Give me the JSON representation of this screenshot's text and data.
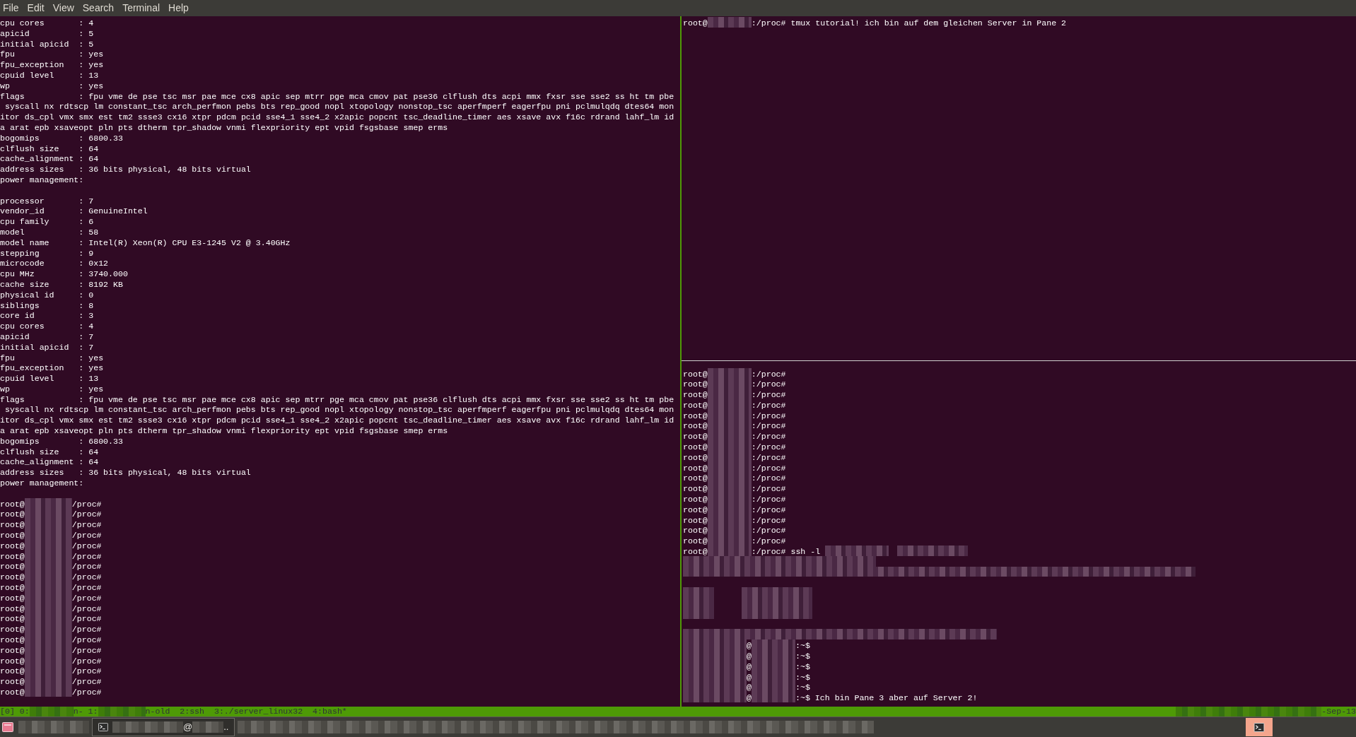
{
  "menu": [
    "File",
    "Edit",
    "View",
    "Search",
    "Terminal",
    "Help"
  ],
  "left_pane": {
    "lines": [
      {
        "kind": "text",
        "text": "cpu cores       : 4"
      },
      {
        "kind": "text",
        "text": "apicid          : 5"
      },
      {
        "kind": "text",
        "text": "initial apicid  : 5"
      },
      {
        "kind": "text",
        "text": "fpu             : yes"
      },
      {
        "kind": "text",
        "text": "fpu_exception   : yes"
      },
      {
        "kind": "text",
        "text": "cpuid level     : 13"
      },
      {
        "kind": "text",
        "text": "wp              : yes"
      },
      {
        "kind": "text",
        "text": "flags           : fpu vme de pse tsc msr pae mce cx8 apic sep mtrr pge mca cmov pat pse36 clflush dts acpi mmx fxsr sse sse2 ss ht tm pbe"
      },
      {
        "kind": "text",
        "text": " syscall nx rdtscp lm constant_tsc arch_perfmon pebs bts rep_good nopl xtopology nonstop_tsc aperfmperf eagerfpu pni pclmulqdq dtes64 mon"
      },
      {
        "kind": "text",
        "text": "itor ds_cpl vmx smx est tm2 ssse3 cx16 xtpr pdcm pcid sse4_1 sse4_2 x2apic popcnt tsc_deadline_timer aes xsave avx f16c rdrand lahf_lm id"
      },
      {
        "kind": "text",
        "text": "a arat epb xsaveopt pln pts dtherm tpr_shadow vnmi flexpriority ept vpid fsgsbase smep erms"
      },
      {
        "kind": "text",
        "text": "bogomips        : 6800.33"
      },
      {
        "kind": "text",
        "text": "clflush size    : 64"
      },
      {
        "kind": "text",
        "text": "cache_alignment : 64"
      },
      {
        "kind": "text",
        "text": "address sizes   : 36 bits physical, 48 bits virtual"
      },
      {
        "kind": "text",
        "text": "power management:"
      },
      {
        "kind": "blank"
      },
      {
        "kind": "text",
        "text": "processor       : 7"
      },
      {
        "kind": "text",
        "text": "vendor_id       : GenuineIntel"
      },
      {
        "kind": "text",
        "text": "cpu family      : 6"
      },
      {
        "kind": "text",
        "text": "model           : 58"
      },
      {
        "kind": "text",
        "text": "model name      : Intel(R) Xeon(R) CPU E3-1245 V2 @ 3.40GHz"
      },
      {
        "kind": "text",
        "text": "stepping        : 9"
      },
      {
        "kind": "text",
        "text": "microcode       : 0x12"
      },
      {
        "kind": "text",
        "text": "cpu MHz         : 3740.000"
      },
      {
        "kind": "text",
        "text": "cache size      : 8192 KB"
      },
      {
        "kind": "text",
        "text": "physical id     : 0"
      },
      {
        "kind": "text",
        "text": "siblings        : 8"
      },
      {
        "kind": "text",
        "text": "core id         : 3"
      },
      {
        "kind": "text",
        "text": "cpu cores       : 4"
      },
      {
        "kind": "text",
        "text": "apicid          : 7"
      },
      {
        "kind": "text",
        "text": "initial apicid  : 7"
      },
      {
        "kind": "text",
        "text": "fpu             : yes"
      },
      {
        "kind": "text",
        "text": "fpu_exception   : yes"
      },
      {
        "kind": "text",
        "text": "cpuid level     : 13"
      },
      {
        "kind": "text",
        "text": "wp              : yes"
      },
      {
        "kind": "text",
        "text": "flags           : fpu vme de pse tsc msr pae mce cx8 apic sep mtrr pge mca cmov pat pse36 clflush dts acpi mmx fxsr sse sse2 ss ht tm pbe"
      },
      {
        "kind": "text",
        "text": " syscall nx rdtscp lm constant_tsc arch_perfmon pebs bts rep_good nopl xtopology nonstop_tsc aperfmperf eagerfpu pni pclmulqdq dtes64 mon"
      },
      {
        "kind": "text",
        "text": "itor ds_cpl vmx smx est tm2 ssse3 cx16 xtpr pdcm pcid sse4_1 sse4_2 x2apic popcnt tsc_deadline_timer aes xsave avx f16c rdrand lahf_lm id"
      },
      {
        "kind": "text",
        "text": "a arat epb xsaveopt pln pts dtherm tpr_shadow vnmi flexpriority ept vpid fsgsbase smep erms"
      },
      {
        "kind": "text",
        "text": "bogomips        : 6800.33"
      },
      {
        "kind": "text",
        "text": "clflush size    : 64"
      },
      {
        "kind": "text",
        "text": "cache_alignment : 64"
      },
      {
        "kind": "text",
        "text": "address sizes   : 36 bits physical, 48 bits virtual"
      },
      {
        "kind": "text",
        "text": "power management:"
      },
      {
        "kind": "blank"
      },
      {
        "kind": "mixed",
        "parts": [
          {
            "kind": "text",
            "text": "root@"
          },
          {
            "kind": "medium"
          },
          {
            "kind": "text",
            "text": "/proc#"
          }
        ]
      },
      {
        "kind": "mixed",
        "parts": [
          {
            "kind": "text",
            "text": "root@"
          },
          {
            "kind": "medium"
          },
          {
            "kind": "text",
            "text": "/proc#"
          }
        ]
      },
      {
        "kind": "mixed",
        "parts": [
          {
            "kind": "text",
            "text": "root@"
          },
          {
            "kind": "medium"
          },
          {
            "kind": "text",
            "text": "/proc#"
          }
        ]
      },
      {
        "kind": "mixed",
        "parts": [
          {
            "kind": "text",
            "text": "root@"
          },
          {
            "kind": "medium"
          },
          {
            "kind": "text",
            "text": "/proc#"
          }
        ]
      },
      {
        "kind": "mixed",
        "parts": [
          {
            "kind": "text",
            "text": "root@"
          },
          {
            "kind": "medium"
          },
          {
            "kind": "text",
            "text": "/proc#"
          }
        ]
      },
      {
        "kind": "mixed",
        "parts": [
          {
            "kind": "text",
            "text": "root@"
          },
          {
            "kind": "medium"
          },
          {
            "kind": "text",
            "text": "/proc#"
          }
        ]
      },
      {
        "kind": "mixed",
        "parts": [
          {
            "kind": "text",
            "text": "root@"
          },
          {
            "kind": "medium"
          },
          {
            "kind": "text",
            "text": "/proc#"
          }
        ]
      },
      {
        "kind": "mixed",
        "parts": [
          {
            "kind": "text",
            "text": "root@"
          },
          {
            "kind": "medium"
          },
          {
            "kind": "text",
            "text": "/proc#"
          }
        ]
      },
      {
        "kind": "mixed",
        "parts": [
          {
            "kind": "text",
            "text": "root@"
          },
          {
            "kind": "medium"
          },
          {
            "kind": "text",
            "text": "/proc#"
          }
        ]
      },
      {
        "kind": "mixed",
        "parts": [
          {
            "kind": "text",
            "text": "root@"
          },
          {
            "kind": "medium"
          },
          {
            "kind": "text",
            "text": "/proc#"
          }
        ]
      },
      {
        "kind": "mixed",
        "parts": [
          {
            "kind": "text",
            "text": "root@"
          },
          {
            "kind": "medium"
          },
          {
            "kind": "text",
            "text": "/proc#"
          }
        ]
      },
      {
        "kind": "mixed",
        "parts": [
          {
            "kind": "text",
            "text": "root@"
          },
          {
            "kind": "medium"
          },
          {
            "kind": "text",
            "text": "/proc#"
          }
        ]
      },
      {
        "kind": "mixed",
        "parts": [
          {
            "kind": "text",
            "text": "root@"
          },
          {
            "kind": "medium"
          },
          {
            "kind": "text",
            "text": "/proc#"
          }
        ]
      },
      {
        "kind": "mixed",
        "parts": [
          {
            "kind": "text",
            "text": "root@"
          },
          {
            "kind": "medium"
          },
          {
            "kind": "text",
            "text": "/proc#"
          }
        ]
      },
      {
        "kind": "mixed",
        "parts": [
          {
            "kind": "text",
            "text": "root@"
          },
          {
            "kind": "medium"
          },
          {
            "kind": "text",
            "text": "/proc#"
          }
        ]
      },
      {
        "kind": "mixed",
        "parts": [
          {
            "kind": "text",
            "text": "root@"
          },
          {
            "kind": "medium"
          },
          {
            "kind": "text",
            "text": "/proc#"
          }
        ]
      },
      {
        "kind": "mixed",
        "parts": [
          {
            "kind": "text",
            "text": "root@"
          },
          {
            "kind": "medium"
          },
          {
            "kind": "text",
            "text": "/proc#"
          }
        ]
      },
      {
        "kind": "mixed",
        "parts": [
          {
            "kind": "text",
            "text": "root@"
          },
          {
            "kind": "medium"
          },
          {
            "kind": "text",
            "text": "/proc#"
          }
        ]
      },
      {
        "kind": "mixed",
        "parts": [
          {
            "kind": "text",
            "text": "root@"
          },
          {
            "kind": "medium"
          },
          {
            "kind": "text",
            "text": "/proc#"
          }
        ]
      }
    ]
  },
  "right_top_pane": {
    "lines": [
      {
        "kind": "mixed",
        "parts": [
          {
            "kind": "text",
            "text": "root@"
          },
          {
            "kind": "short"
          },
          {
            "kind": "text",
            "text": ":/proc# tmux tutorial! ich bin auf dem gleichen Server in Pane 2"
          }
        ]
      }
    ]
  },
  "right_bottom_pane": {
    "lines": [
      {
        "kind": "mixed",
        "parts": [
          {
            "kind": "text",
            "text": "root@"
          },
          {
            "kind": "short"
          },
          {
            "kind": "text",
            "text": ":/proc#"
          }
        ]
      },
      {
        "kind": "mixed",
        "parts": [
          {
            "kind": "text",
            "text": "root@"
          },
          {
            "kind": "short"
          },
          {
            "kind": "text",
            "text": ":/proc#"
          }
        ]
      },
      {
        "kind": "mixed",
        "parts": [
          {
            "kind": "text",
            "text": "root@"
          },
          {
            "kind": "short"
          },
          {
            "kind": "text",
            "text": ":/proc#"
          }
        ]
      },
      {
        "kind": "mixed",
        "parts": [
          {
            "kind": "text",
            "text": "root@"
          },
          {
            "kind": "short"
          },
          {
            "kind": "text",
            "text": ":/proc#"
          }
        ]
      },
      {
        "kind": "mixed",
        "parts": [
          {
            "kind": "text",
            "text": "root@"
          },
          {
            "kind": "short"
          },
          {
            "kind": "text",
            "text": ":/proc#"
          }
        ]
      },
      {
        "kind": "mixed",
        "parts": [
          {
            "kind": "text",
            "text": "root@"
          },
          {
            "kind": "short"
          },
          {
            "kind": "text",
            "text": ":/proc#"
          }
        ]
      },
      {
        "kind": "mixed",
        "parts": [
          {
            "kind": "text",
            "text": "root@"
          },
          {
            "kind": "short"
          },
          {
            "kind": "text",
            "text": ":/proc#"
          }
        ]
      },
      {
        "kind": "mixed",
        "parts": [
          {
            "kind": "text",
            "text": "root@"
          },
          {
            "kind": "short"
          },
          {
            "kind": "text",
            "text": ":/proc#"
          }
        ]
      },
      {
        "kind": "mixed",
        "parts": [
          {
            "kind": "text",
            "text": "root@"
          },
          {
            "kind": "short"
          },
          {
            "kind": "text",
            "text": ":/proc#"
          }
        ]
      },
      {
        "kind": "mixed",
        "parts": [
          {
            "kind": "text",
            "text": "root@"
          },
          {
            "kind": "short"
          },
          {
            "kind": "text",
            "text": ":/proc#"
          }
        ]
      },
      {
        "kind": "mixed",
        "parts": [
          {
            "kind": "text",
            "text": "root@"
          },
          {
            "kind": "short"
          },
          {
            "kind": "text",
            "text": ":/proc#"
          }
        ]
      },
      {
        "kind": "mixed",
        "parts": [
          {
            "kind": "text",
            "text": "root@"
          },
          {
            "kind": "short"
          },
          {
            "kind": "text",
            "text": ":/proc#"
          }
        ]
      },
      {
        "kind": "mixed",
        "parts": [
          {
            "kind": "text",
            "text": "root@"
          },
          {
            "kind": "short"
          },
          {
            "kind": "text",
            "text": ":/proc#"
          }
        ]
      },
      {
        "kind": "mixed",
        "parts": [
          {
            "kind": "text",
            "text": "root@"
          },
          {
            "kind": "short"
          },
          {
            "kind": "text",
            "text": ":/proc#"
          }
        ]
      },
      {
        "kind": "mixed",
        "parts": [
          {
            "kind": "text",
            "text": "root@"
          },
          {
            "kind": "short"
          },
          {
            "kind": "text",
            "text": ":/proc#"
          }
        ]
      },
      {
        "kind": "mixed",
        "parts": [
          {
            "kind": "text",
            "text": "root@"
          },
          {
            "kind": "short"
          },
          {
            "kind": "text",
            "text": ":/proc#"
          }
        ]
      },
      {
        "kind": "mixed",
        "parts": [
          {
            "kind": "text",
            "text": "root@"
          },
          {
            "kind": "short"
          },
          {
            "kind": "text",
            "text": ":/proc#"
          }
        ]
      },
      {
        "kind": "mixed",
        "parts": [
          {
            "kind": "text",
            "text": "root@"
          },
          {
            "kind": "short"
          },
          {
            "kind": "text",
            "text": ":/proc# ssh -l "
          },
          {
            "kind": "word"
          },
          {
            "kind": "space"
          },
          {
            "kind": "long"
          }
        ]
      },
      {
        "kind": "mixed",
        "parts": [
          {
            "kind": "phrase"
          }
        ]
      },
      {
        "kind": "mixed",
        "parts": [
          {
            "kind": "wide"
          }
        ]
      },
      {
        "kind": "blank"
      },
      {
        "kind": "mixed",
        "parts": [
          {
            "kind": "tiny"
          },
          {
            "kind": "indent"
          },
          {
            "kind": "long"
          }
        ]
      },
      {
        "kind": "mixed",
        "parts": [
          {
            "kind": "tiny"
          },
          {
            "kind": "indent"
          },
          {
            "kind": "long"
          }
        ]
      },
      {
        "kind": "mixed",
        "parts": [
          {
            "kind": "tiny"
          },
          {
            "kind": "indent"
          },
          {
            "kind": "long"
          }
        ]
      },
      {
        "kind": "blank"
      },
      {
        "kind": "mixed",
        "parts": [
          {
            "kind": "sentence"
          }
        ]
      },
      {
        "kind": "mixed",
        "parts": [
          {
            "kind": "word"
          },
          {
            "kind": "text",
            "text": "@"
          },
          {
            "kind": "short"
          },
          {
            "kind": "text",
            "text": ":~$"
          }
        ]
      },
      {
        "kind": "mixed",
        "parts": [
          {
            "kind": "word"
          },
          {
            "kind": "text",
            "text": "@"
          },
          {
            "kind": "short"
          },
          {
            "kind": "text",
            "text": ":~$"
          }
        ]
      },
      {
        "kind": "mixed",
        "parts": [
          {
            "kind": "word"
          },
          {
            "kind": "text",
            "text": "@"
          },
          {
            "kind": "short"
          },
          {
            "kind": "text",
            "text": ":~$"
          }
        ]
      },
      {
        "kind": "mixed",
        "parts": [
          {
            "kind": "word"
          },
          {
            "kind": "text",
            "text": "@"
          },
          {
            "kind": "short"
          },
          {
            "kind": "text",
            "text": ":~$"
          }
        ]
      },
      {
        "kind": "mixed",
        "parts": [
          {
            "kind": "word"
          },
          {
            "kind": "text",
            "text": "@"
          },
          {
            "kind": "short"
          },
          {
            "kind": "text",
            "text": ":~$"
          }
        ]
      },
      {
        "kind": "mixed",
        "parts": [
          {
            "kind": "word"
          },
          {
            "kind": "text",
            "text": "@"
          },
          {
            "kind": "short"
          },
          {
            "kind": "text",
            "text": ":~$ Ich bin Pane 3 aber auf Server 2!"
          }
        ]
      }
    ]
  },
  "status_bar": {
    "left_parts": [
      {
        "kind": "text",
        "text": "[0] 0:"
      },
      {
        "kind": "short"
      },
      {
        "kind": "text",
        "text": "n- 1:"
      },
      {
        "kind": "medium"
      },
      {
        "kind": "text",
        "text": "n-old  2:ssh  3:./server_linux32  4:bash*"
      }
    ],
    "right_parts": [
      {
        "kind": "status"
      },
      {
        "kind": "text",
        "text": "-Sep-13"
      }
    ]
  },
  "taskbar": {
    "items": [
      {
        "kind": "app_icon"
      },
      {
        "kind": "long"
      },
      {
        "kind": "task",
        "selected": true,
        "parts": [
          {
            "kind": "long"
          },
          {
            "kind": "text",
            "text": "@"
          },
          {
            "kind": "tiny"
          },
          {
            "kind": "text",
            "text": ".."
          }
        ]
      },
      {
        "kind": "huge"
      },
      {
        "kind": "spacer"
      },
      {
        "kind": "tray_button",
        "selected": true
      }
    ]
  }
}
